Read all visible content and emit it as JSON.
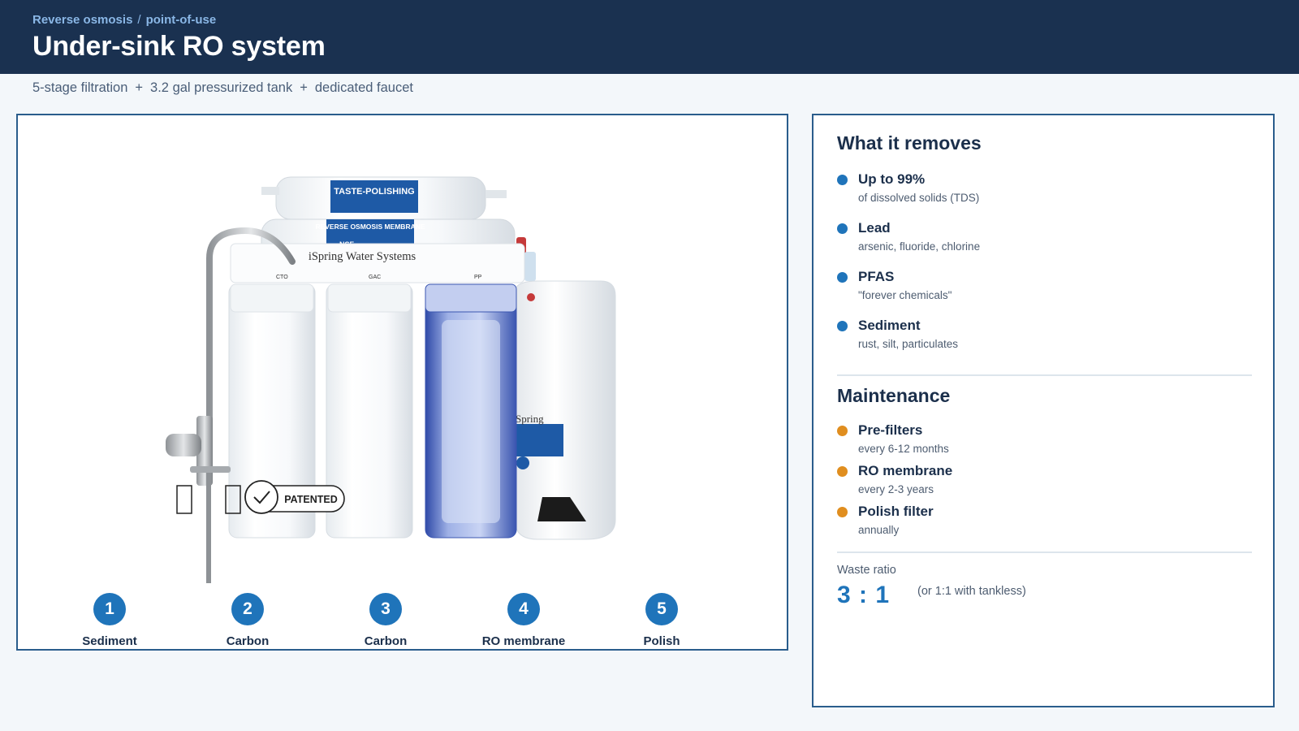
{
  "header": {
    "breadcrumb": [
      "Reverse osmosis",
      "point-of-use"
    ],
    "title": "Under-sink RO system"
  },
  "subtitle": [
    "5-stage filtration",
    "3.2 gal pressurized tank",
    "dedicated faucet"
  ],
  "product_image": {
    "brand_text": "iSpring Water Systems",
    "filter_labels": [
      "TASTE-POLISHING",
      "REVERSE OSMOSIS MEMBRANE",
      "NSF"
    ],
    "housing_codes": [
      "CTO",
      "GAC",
      "PP"
    ],
    "badge": "PATENTED",
    "tank_text": "Spring"
  },
  "stages": [
    {
      "num": "1",
      "label": "Sediment"
    },
    {
      "num": "2",
      "label": "Carbon"
    },
    {
      "num": "3",
      "label": "Carbon"
    },
    {
      "num": "4",
      "label": "RO membrane"
    },
    {
      "num": "5",
      "label": "Polish"
    }
  ],
  "removes": {
    "title": "What it removes",
    "items": [
      {
        "title": "Up to 99%",
        "sub": "of dissolved solids (TDS)"
      },
      {
        "title": "Lead",
        "sub": "arsenic, fluoride, chlorine"
      },
      {
        "title": "PFAS",
        "sub": "\"forever chemicals\""
      },
      {
        "title": "Sediment",
        "sub": "rust, silt, particulates"
      }
    ]
  },
  "maintenance": {
    "title": "Maintenance",
    "items": [
      {
        "title": "Pre-filters",
        "sub": "every 6-12 months"
      },
      {
        "title": "RO membrane",
        "sub": "every 2-3 years"
      },
      {
        "title": "Polish filter",
        "sub": "annually"
      }
    ]
  },
  "waste": {
    "label": "Waste ratio",
    "value": "3 : 1",
    "note": "(or 1:1 with tankless)"
  },
  "colors": {
    "header_bg": "#1a3150",
    "accent_blue": "#1f74ba",
    "accent_orange": "#e08e1f",
    "breadcrumb": "#8ab7e6",
    "panel_border": "#2a5d8c"
  }
}
